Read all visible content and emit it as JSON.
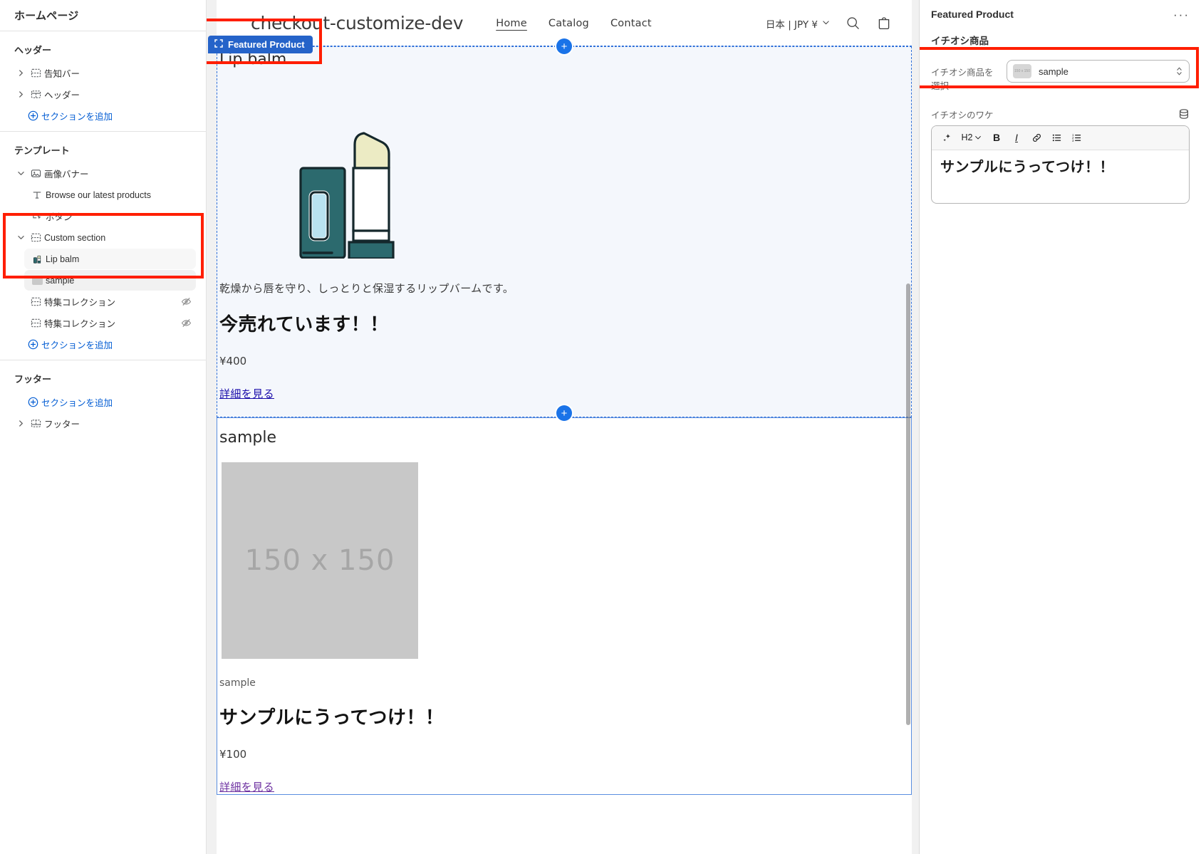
{
  "sidebar": {
    "title": "ホームページ",
    "groups": [
      {
        "name": "ヘッダー",
        "rows": [
          {
            "label": "告知バー",
            "icon": "section-icon",
            "chevron": "right",
            "indent": false,
            "hidden": false
          },
          {
            "label": "ヘッダー",
            "icon": "header-icon",
            "chevron": "right",
            "indent": false,
            "hidden": false
          }
        ],
        "add_label": "セクションを追加"
      },
      {
        "name": "テンプレート",
        "rows": [
          {
            "label": "画像バナー",
            "icon": "image-banner-icon",
            "chevron": "down",
            "indent": false,
            "hidden": false
          },
          {
            "label": "Browse our latest products",
            "icon": "text-icon",
            "chevron": "none",
            "indent": true,
            "hidden": false
          },
          {
            "label": "ボタン",
            "icon": "button-icon",
            "chevron": "none",
            "indent": true,
            "hidden": false
          },
          {
            "label": "Custom section",
            "icon": "section-icon",
            "chevron": "down",
            "indent": false,
            "hidden": false,
            "selected": false
          },
          {
            "label": "Lip balm",
            "icon": "lipbalm-thumb",
            "chevron": "none",
            "indent": true,
            "hidden": false,
            "selected2": true
          },
          {
            "label": "sample",
            "icon": "sample-thumb",
            "chevron": "none",
            "indent": true,
            "hidden": false,
            "selected": true
          },
          {
            "label": "特集コレクション",
            "icon": "section-icon",
            "chevron": "none",
            "indent": false,
            "hidden": true
          },
          {
            "label": "特集コレクション",
            "icon": "section-icon",
            "chevron": "none",
            "indent": false,
            "hidden": true
          }
        ],
        "add_label": "セクションを追加"
      },
      {
        "name": "フッター",
        "rows": [
          {
            "label": "フッター",
            "icon": "footer-icon",
            "chevron": "right",
            "indent": false,
            "hidden": false
          }
        ],
        "add_label": "セクションを追加",
        "add_first": true
      }
    ]
  },
  "preview": {
    "section_badge": "Featured Product",
    "store": {
      "name": "checkout-customize-dev",
      "nav": [
        {
          "label": "Home",
          "active": true
        },
        {
          "label": "Catalog",
          "active": false
        },
        {
          "label": "Contact",
          "active": false
        }
      ],
      "locale": "日本 | JPY ¥",
      "search_icon": "search-icon",
      "cart_icon": "cart-icon"
    },
    "featured_section": {
      "product_title": "Lip balm",
      "description": "乾燥から唇を守り、しっとりと保湿するリップバームです。",
      "heading": "今売れています！！",
      "price": "¥400",
      "link": "詳細を見る"
    },
    "sample_section": {
      "section_title": "sample",
      "image_placeholder": "150 x 150",
      "caption": "sample",
      "heading": "サンプルにうってつけ！！",
      "price": "¥100",
      "link": "詳細を見る"
    },
    "add_section_button": "+"
  },
  "right_panel": {
    "title": "Featured Product",
    "more_menu": "···",
    "subheading": "イチオシ商品",
    "product_field": {
      "label": "イチオシ商品を選択",
      "value": "sample",
      "thumb": "product-thumb"
    },
    "rich_text": {
      "label": "イチオシのワケ",
      "source_icon": "database-icon",
      "toolbar": [
        {
          "name": "ai-sparkle-icon",
          "glyph": "✦"
        },
        {
          "name": "heading-select",
          "glyph": "H2"
        },
        {
          "name": "bold-icon",
          "glyph": "B"
        },
        {
          "name": "italic-icon",
          "glyph": "I"
        },
        {
          "name": "link-icon",
          "glyph": "🔗"
        },
        {
          "name": "bulleted-list-icon",
          "glyph": "≔"
        },
        {
          "name": "numbered-list-icon",
          "glyph": "≕"
        }
      ],
      "content": "サンプルにうってつけ！！"
    }
  },
  "colors": {
    "accent_blue": "#005bd3",
    "selection_blue": "#2563c9",
    "annotation_red": "#ff1e00",
    "preview_section_bg": "#f4f7fc",
    "link_blue": "#1a0dab",
    "link_visited": "#6c2fa0"
  }
}
